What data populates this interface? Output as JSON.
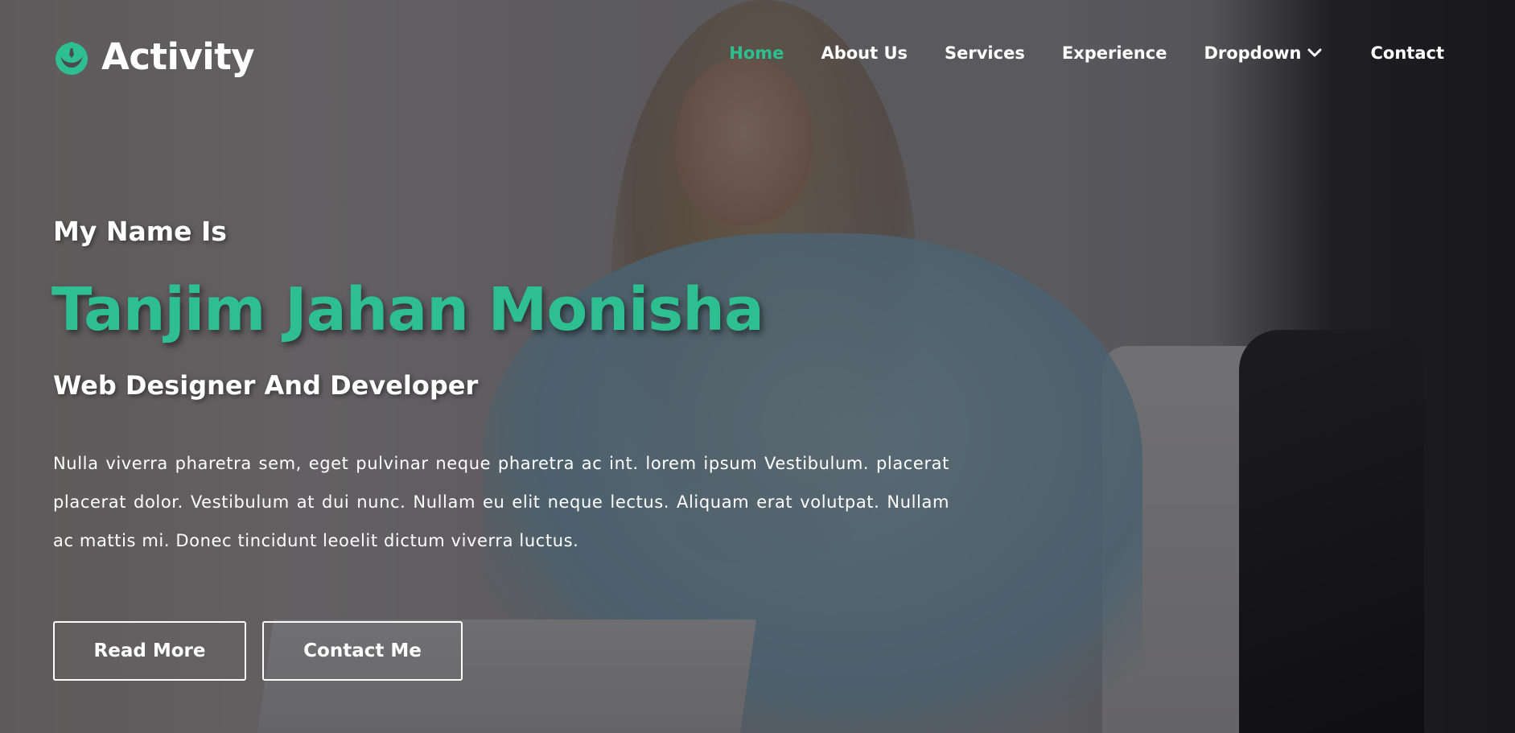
{
  "brand": {
    "name": "Activity",
    "icon": "rebel-alliance-icon",
    "accent_color": "#2ebf91"
  },
  "nav": {
    "items": [
      {
        "label": "Home",
        "active": true
      },
      {
        "label": "About Us",
        "active": false
      },
      {
        "label": "Services",
        "active": false
      },
      {
        "label": "Experience",
        "active": false
      },
      {
        "label": "Dropdown",
        "active": false,
        "icon": "chevron-down-icon"
      },
      {
        "label": "Contact",
        "active": false
      }
    ]
  },
  "hero": {
    "intro": "My Name Is",
    "name": "Tanjim Jahan Monisha",
    "role": "Web Designer And Developer",
    "description": "Nulla viverra pharetra sem, eget pulvinar neque pharetra ac int. lorem ipsum Vestibulum. placerat placerat dolor. Vestibulum at dui nunc. Nullam eu elit neque lectus. Aliquam erat volutpat. Nullam ac mattis mi. Donec tincidunt leoelit dictum viverra luctus.",
    "buttons": {
      "read_more": "Read More",
      "contact_me": "Contact Me"
    }
  }
}
